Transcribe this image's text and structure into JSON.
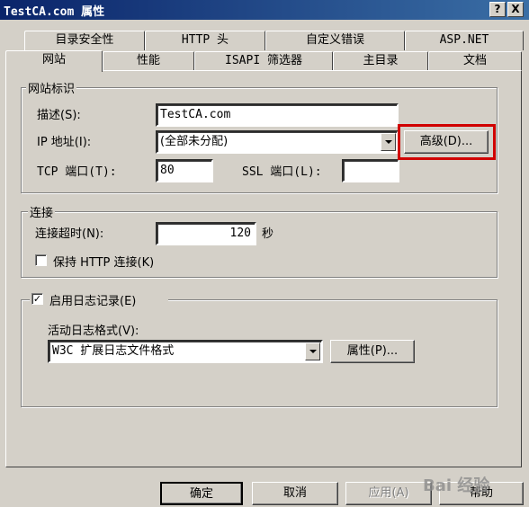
{
  "window": {
    "title": "TestCA.com 属性",
    "help_btn": "?",
    "close_btn": "X"
  },
  "tabs_row1": [
    "目录安全性",
    "HTTP 头",
    "自定义错误",
    "ASP.NET"
  ],
  "tabs_row2": [
    "网站",
    "性能",
    "ISAPI 筛选器",
    "主目录",
    "文档"
  ],
  "website_id": {
    "legend": "网站标识",
    "desc_label": "描述(S):",
    "desc_value": "TestCA.com",
    "ip_label": "IP 地址(I):",
    "ip_value": "(全部未分配)",
    "advanced_btn": "高级(D)...",
    "tcp_label": "TCP 端口(T):",
    "tcp_value": "80",
    "ssl_label": "SSL 端口(L):",
    "ssl_value": ""
  },
  "connection": {
    "legend": "连接",
    "timeout_label": "连接超时(N):",
    "timeout_value": "120",
    "timeout_unit": "秒",
    "keepalive_label": "保持 HTTP 连接(K)",
    "keepalive_checked": false
  },
  "logging": {
    "legend": "启用日志记录(E)",
    "enabled": true,
    "enabled_mark": "✓",
    "format_label": "活动日志格式(V):",
    "format_value": "W3C 扩展日志文件格式",
    "props_btn": "属性(P)..."
  },
  "footer": {
    "ok": "确定",
    "cancel": "取消",
    "apply": "应用(A)",
    "help": "帮助"
  },
  "watermark": "Bai 经验"
}
